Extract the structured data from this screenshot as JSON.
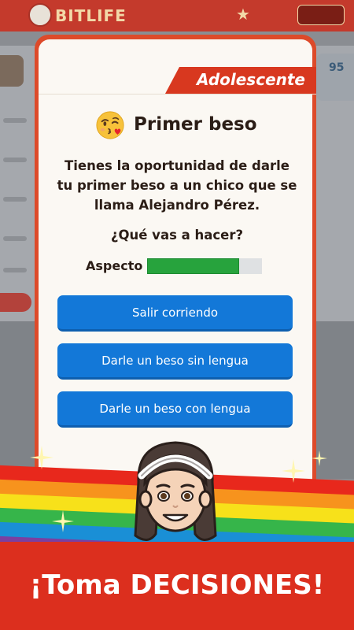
{
  "background_app": {
    "logo_text": "BITLIFE",
    "side_stat": "95"
  },
  "event": {
    "category": "Adolescente",
    "title": "Primer beso",
    "emoji_icon": "kissing-face-winking-icon",
    "description": "Tienes la oportunidad de darle tu primer beso a un chico que se llama Alejandro Pérez.",
    "question": "¿Qué vas a hacer?",
    "stat": {
      "label": "Aspecto",
      "value_fraction": 0.8,
      "color": "#27a33d"
    },
    "choices": [
      {
        "label": "Salir corriendo"
      },
      {
        "label": "Darle un beso sin lengua"
      },
      {
        "label": "Darle un beso con lengua"
      }
    ]
  },
  "promo": {
    "headline": "¡Toma DECISIONES!",
    "rainbow_colors": [
      "#e8281c",
      "#f7931d",
      "#f7e11a",
      "#36b54a",
      "#1a8fd6",
      "#7b3fa0"
    ]
  },
  "colors": {
    "accent_red": "#dd4a2a",
    "button_blue": "#1378d8",
    "card_bg": "#fbf8f3"
  }
}
